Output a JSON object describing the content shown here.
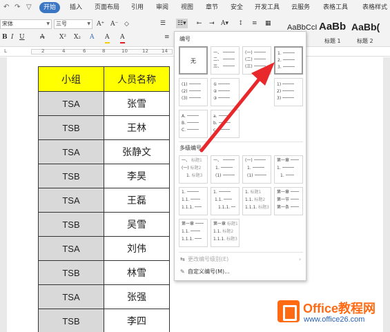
{
  "menubar": {
    "quick_access": [
      "↶",
      "↷",
      "▽"
    ],
    "active_tab": "开始",
    "tabs": [
      "插入",
      "页面布局",
      "引用",
      "审阅",
      "视图",
      "章节",
      "安全",
      "开发工具",
      "云服务",
      "表格工具",
      "表格样式"
    ]
  },
  "toolbar": {
    "font_name": "宋体",
    "font_size": "三号",
    "font_buttons": [
      "A⁺",
      "A⁻",
      "◇"
    ],
    "format_buttons": [
      "B",
      "I",
      "U",
      "A",
      "X²",
      "X₂",
      "A",
      "A",
      "A"
    ],
    "styles": [
      {
        "sample": "AaBbCcI",
        "label": ""
      },
      {
        "sample": "AaBb",
        "label": "标题 1"
      },
      {
        "sample": "AaBb(",
        "label": "标题 2"
      }
    ]
  },
  "ruler": {
    "numbers": [
      "2",
      "4",
      "6",
      "8",
      "10",
      "12",
      "14"
    ]
  },
  "table": {
    "header": [
      "小组",
      "人员名称"
    ],
    "rows": [
      [
        "TSA",
        "张雪"
      ],
      [
        "TSB",
        "王林"
      ],
      [
        "TSA",
        "张静文"
      ],
      [
        "TSB",
        "李昊"
      ],
      [
        "TSA",
        "王磊"
      ],
      [
        "TSB",
        "吴雪"
      ],
      [
        "TSA",
        "刘伟"
      ],
      [
        "TSB",
        "林雪"
      ],
      [
        "TSA",
        "张强"
      ],
      [
        "TSB",
        "李四"
      ]
    ]
  },
  "numbering_panel": {
    "section_numbering": "编号",
    "none_label": "无",
    "single_level": [
      [
        "一、",
        "二、",
        "三、"
      ],
      [
        "(一)",
        "(二)",
        "(三)"
      ],
      [
        "1.",
        "2.",
        "3."
      ],
      [
        "(1)",
        "(2)",
        "(3)"
      ],
      [
        "①",
        "②",
        "③"
      ],
      [
        "1)",
        "2)",
        "3)"
      ],
      [
        "A.",
        "B.",
        "C."
      ],
      [
        "a.",
        "b.",
        "c."
      ]
    ],
    "section_multilevel": "多级编号",
    "multi_level": [
      [
        {
          "num": "一、",
          "text": "标题1"
        },
        {
          "num": "(一)",
          "text": "标题2"
        },
        {
          "num": "1.",
          "text": "标题3"
        }
      ],
      [
        {
          "num": "一、",
          "text": ""
        },
        {
          "num": "1.",
          "text": ""
        },
        {
          "num": "(1)",
          "text": ""
        }
      ],
      [
        {
          "num": "(一)",
          "text": ""
        },
        {
          "num": "1.",
          "text": ""
        },
        {
          "num": "(1)",
          "text": ""
        }
      ],
      [
        {
          "num": "第一章",
          "text": ""
        },
        {
          "num": "1.",
          "text": ""
        },
        {
          "num": "1.",
          "text": ""
        }
      ],
      [
        {
          "num": "1.",
          "text": ""
        },
        {
          "num": "1.1.",
          "text": ""
        },
        {
          "num": "1.1.1.",
          "text": ""
        }
      ],
      [
        {
          "num": "1.",
          "text": ""
        },
        {
          "num": "1.1.",
          "text": ""
        },
        {
          "num": "1.1.1.",
          "text": ""
        }
      ],
      [
        {
          "num": "1.",
          "text": "标题1"
        },
        {
          "num": "1.1.",
          "text": "标题2"
        },
        {
          "num": "1.1.1.",
          "text": "标题3"
        }
      ],
      [
        {
          "num": "第一章",
          "text": ""
        },
        {
          "num": "第一节",
          "text": ""
        },
        {
          "num": "第一条",
          "text": ""
        }
      ],
      [
        {
          "num": "第一章",
          "text": ""
        },
        {
          "num": "1.1.",
          "text": ""
        },
        {
          "num": "1.1.1.",
          "text": ""
        }
      ],
      [
        {
          "num": "第一章",
          "text": "标题1"
        },
        {
          "num": "1.1.",
          "text": "标题2"
        },
        {
          "num": "1.1.1.",
          "text": "标题3"
        }
      ]
    ],
    "change_level_label": "更改编号级别(E)",
    "custom_label": "自定义编号(M)..."
  },
  "watermark": {
    "title": "Office教程网",
    "url": "www.office26.com"
  },
  "colors": {
    "accent_tab": "#3a76c4",
    "header_fill": "#ffff00",
    "group_fill": "#d9d9d9",
    "arrow": "#e8282b",
    "watermark_orange": "#ff6a13",
    "watermark_blue": "#2a62b8"
  }
}
